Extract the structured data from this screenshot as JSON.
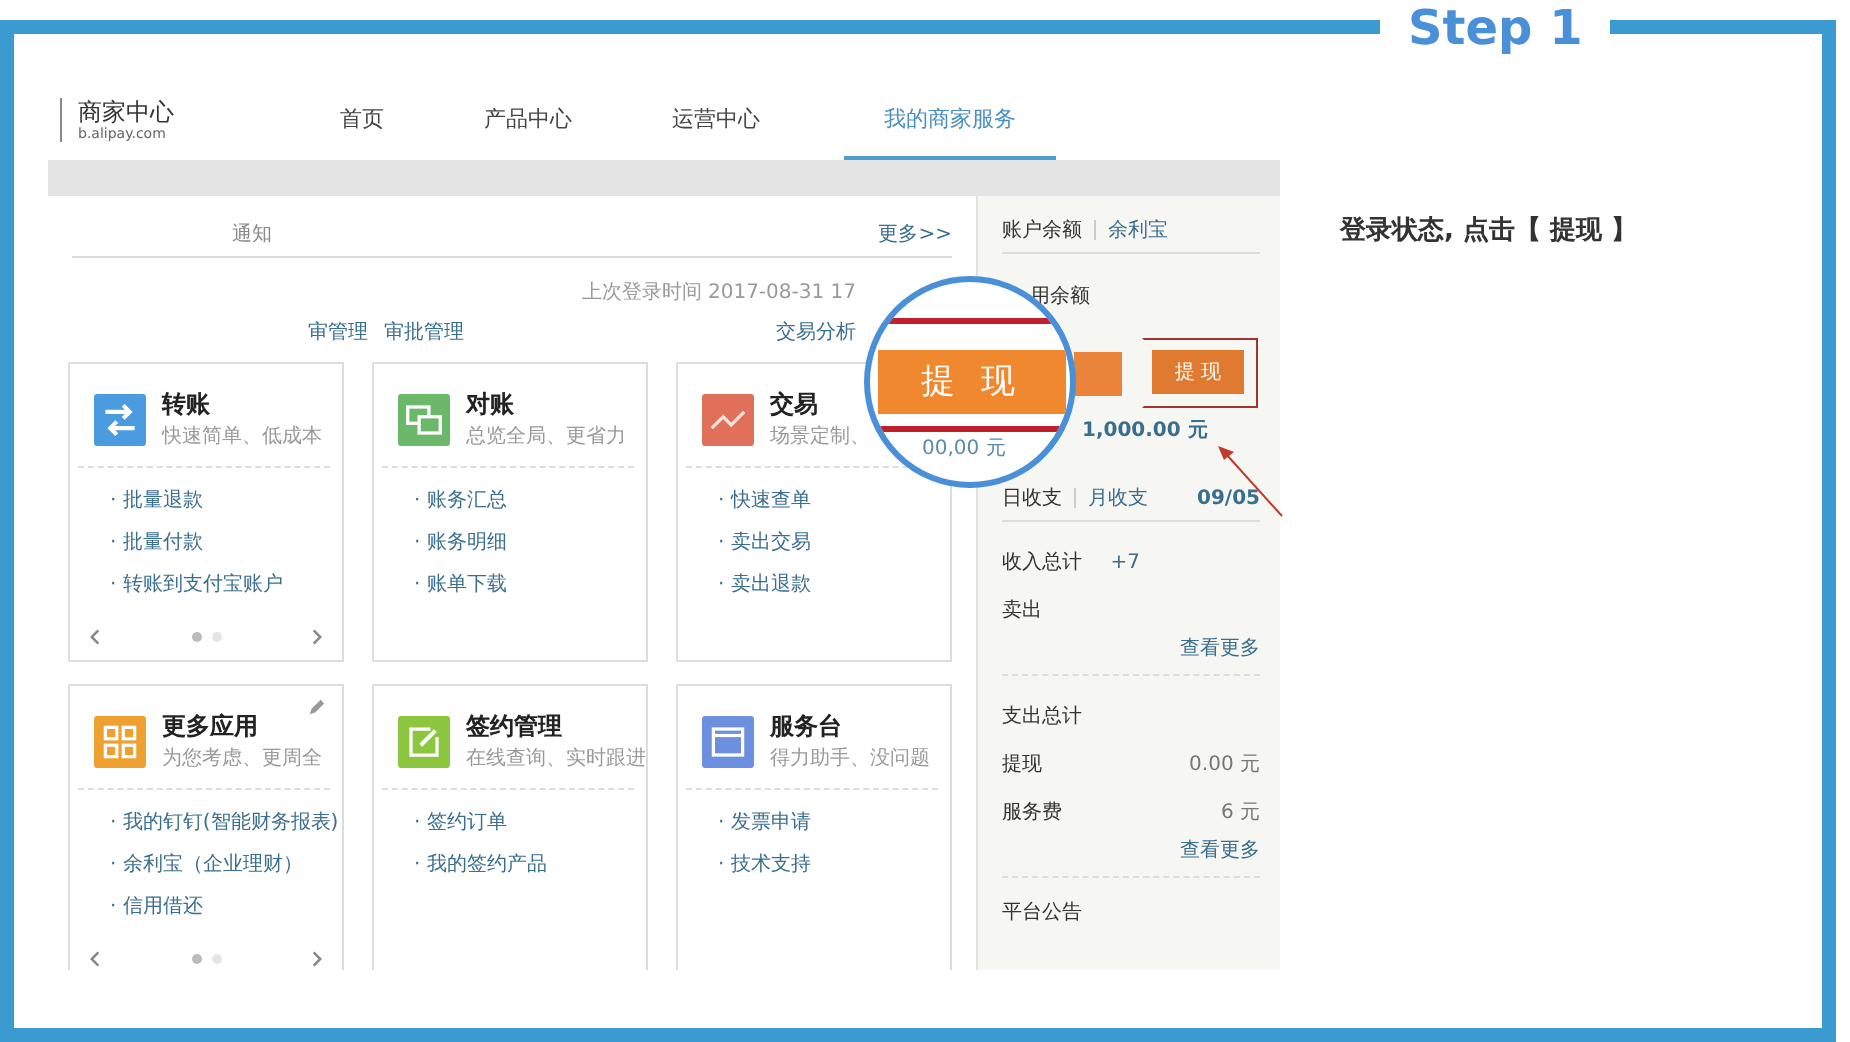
{
  "header": {
    "step": "Step 1"
  },
  "instruction": "登录状态, 点击【 提现 】",
  "screen": {
    "logo": {
      "name": "商家中心",
      "domain": "b.alipay.com"
    },
    "nav": [
      {
        "label": "首页",
        "selected": false
      },
      {
        "label": "产品中心",
        "selected": false
      },
      {
        "label": "运营中心",
        "selected": false
      },
      {
        "label": "我的商家服务",
        "selected": true
      }
    ],
    "notice": {
      "text": "通知",
      "more": "更多>>"
    },
    "account": {
      "last_login": "上次登录时间 2017-08-31 17",
      "links": [
        "审管理",
        "审批管理"
      ],
      "analysis": "交易分析"
    },
    "cards": [
      {
        "kind": "transfer",
        "title": "转账",
        "subtitle": "快速简单、低成本",
        "color": "#4a9be0",
        "editable": false,
        "links": [
          "· 批量退款",
          "· 批量付款",
          "· 转账到支付宝账户"
        ],
        "pager_dots": [
          {
            "selected": true
          },
          {
            "selected": false
          }
        ]
      },
      {
        "kind": "reconcile",
        "title": "对账",
        "subtitle": "总览全局、更省力",
        "color": "#6bb86a",
        "editable": false,
        "links": [
          "· 账务汇总",
          "· 账务明细",
          "· 账单下载"
        ]
      },
      {
        "kind": "trade",
        "title": "交易",
        "subtitle": "场景定制、",
        "color": "#e0705a",
        "editable": false,
        "links": [
          "· 快速查单",
          "· 卖出交易",
          "· 卖出退款"
        ]
      },
      {
        "kind": "apps",
        "title": "更多应用",
        "subtitle": "为您考虑、更周全",
        "color": "#eea030",
        "editable": true,
        "links": [
          "· 我的钉钉(智能财务报表)",
          "· 余利宝（企业理财）",
          "· 信用借还"
        ],
        "pager_dots": [
          {
            "selected": true
          },
          {
            "selected": false
          }
        ]
      },
      {
        "kind": "contract",
        "title": "签约管理",
        "subtitle": "在线查询、实时跟进",
        "color": "#8cc63f",
        "editable": false,
        "links": [
          "· 签约订单",
          "· 我的签约产品"
        ]
      },
      {
        "kind": "service",
        "title": "服务台",
        "subtitle": "得力助手、没问题",
        "color": "#6d8fe0",
        "editable": false,
        "links": [
          "· 发票申请",
          "· 技术支持"
        ]
      }
    ],
    "balance_panel": {
      "tabs": [
        {
          "label": "账户余额",
          "selected": true
        },
        {
          "label": "余利宝",
          "selected": false
        }
      ],
      "available_label": "用余额",
      "withdraw_button": "提 现",
      "amount": "1,000.00 元",
      "period_tabs": [
        {
          "label": "日收支",
          "selected": true
        },
        {
          "label": "月收支",
          "selected": false
        }
      ],
      "date": "09/05",
      "sections": [
        {
          "rows": [
            {
              "label": "收入总计",
              "value": "+7"
            },
            {
              "label": "卖出"
            }
          ],
          "more": "查看更多"
        },
        {
          "rows": [
            {
              "label": "支出总计"
            },
            {
              "label": "提现",
              "value": "0.00 元"
            },
            {
              "label": "服务费",
              "value": "6 元"
            }
          ],
          "more": "查看更多"
        }
      ],
      "announcement": "平台公告"
    }
  },
  "magnifier": {
    "button": "提 现",
    "amount": "00,00 元"
  }
}
